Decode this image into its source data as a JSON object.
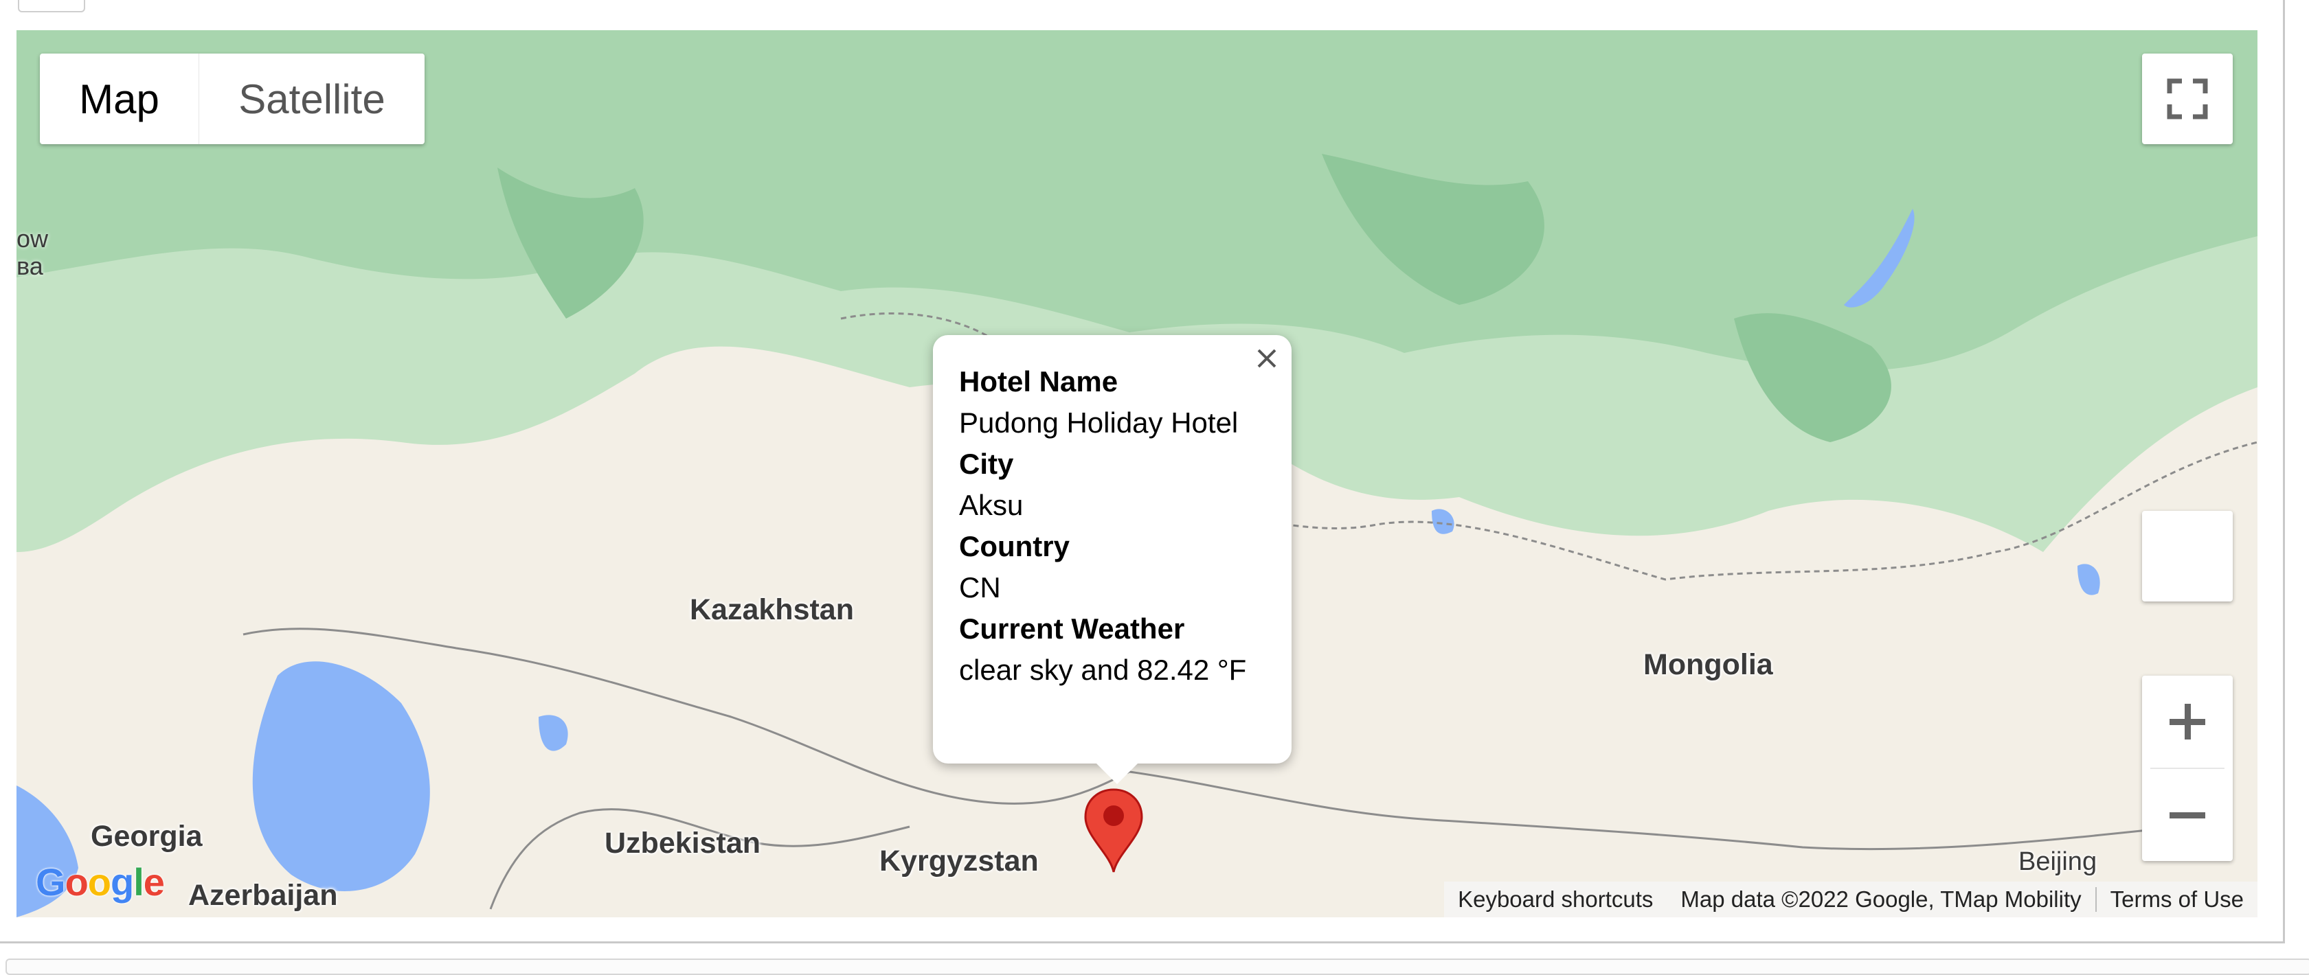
{
  "map": {
    "type_control": {
      "map_label": "Map",
      "satellite_label": "Satellite",
      "selected": "Map"
    },
    "labels": {
      "kazakhstan": "Kazakhstan",
      "mongolia": "Mongolia",
      "georgia": "Georgia",
      "uzbekistan": "Uzbekistan",
      "kyrgyzstan": "Kyrgyzstan",
      "azerbaijan": "Azerbaijan",
      "beijing": "Beijing",
      "edge_top": "ow",
      "edge_bottom": "ва"
    },
    "infowindow": {
      "hotel_name_label": "Hotel Name",
      "hotel_name": "Pudong Holiday Hotel",
      "city_label": "City",
      "city": "Aksu",
      "country_label": "Country",
      "country": "CN",
      "weather_label": "Current Weather",
      "weather": "clear sky and 82.42 °F"
    },
    "attribution": {
      "keyboard_shortcuts": "Keyboard shortcuts",
      "map_data": "Map data ©2022 Google, TMap Mobility",
      "terms": "Terms of Use"
    },
    "logo_text": "Google",
    "icons": {
      "fullscreen": "fullscreen-icon",
      "zoom_in": "plus-icon",
      "zoom_out": "minus-icon",
      "close": "close-icon",
      "marker": "map-pin-icon"
    },
    "colors": {
      "forest": "#a8d5ae",
      "grassland": "#c4e3c5",
      "steppe": "#f3efe6",
      "water": "#8ab4f8",
      "marker": "#ea4335"
    }
  }
}
